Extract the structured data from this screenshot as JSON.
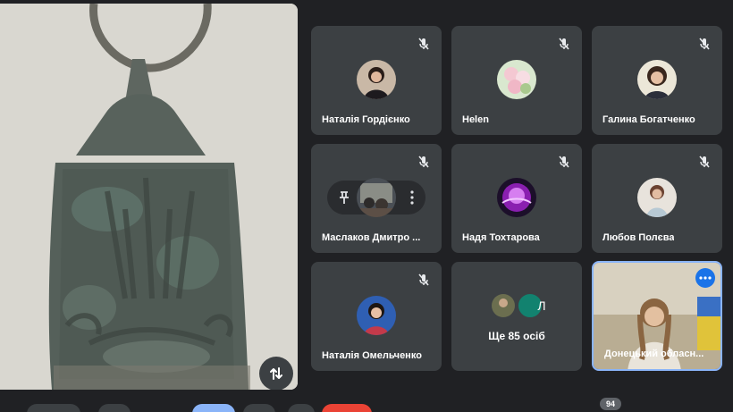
{
  "presentation": {
    "swap_icon": "swap-vertical-icon"
  },
  "participants": [
    {
      "name": "Наталія Гордієнко",
      "muted": true
    },
    {
      "name": "Helen",
      "muted": true
    },
    {
      "name": "Галина Богатченко",
      "muted": true
    },
    {
      "name": "Маслаков Дмитро ...",
      "muted": true
    },
    {
      "name": "Надя Тохтарова",
      "muted": true
    },
    {
      "name": "Любов Полєва",
      "muted": true
    },
    {
      "name": "Наталія Омельченко",
      "muted": true
    }
  ],
  "others": {
    "label": "Ще 85 осіб",
    "avatar_letter": "Л"
  },
  "self": {
    "name": "Донецький обласн..."
  },
  "people_badge": "94",
  "colors": {
    "background": "#202124",
    "tile": "#3c4043",
    "accent": "#1a73e8",
    "self_border": "#8ab4f8"
  }
}
